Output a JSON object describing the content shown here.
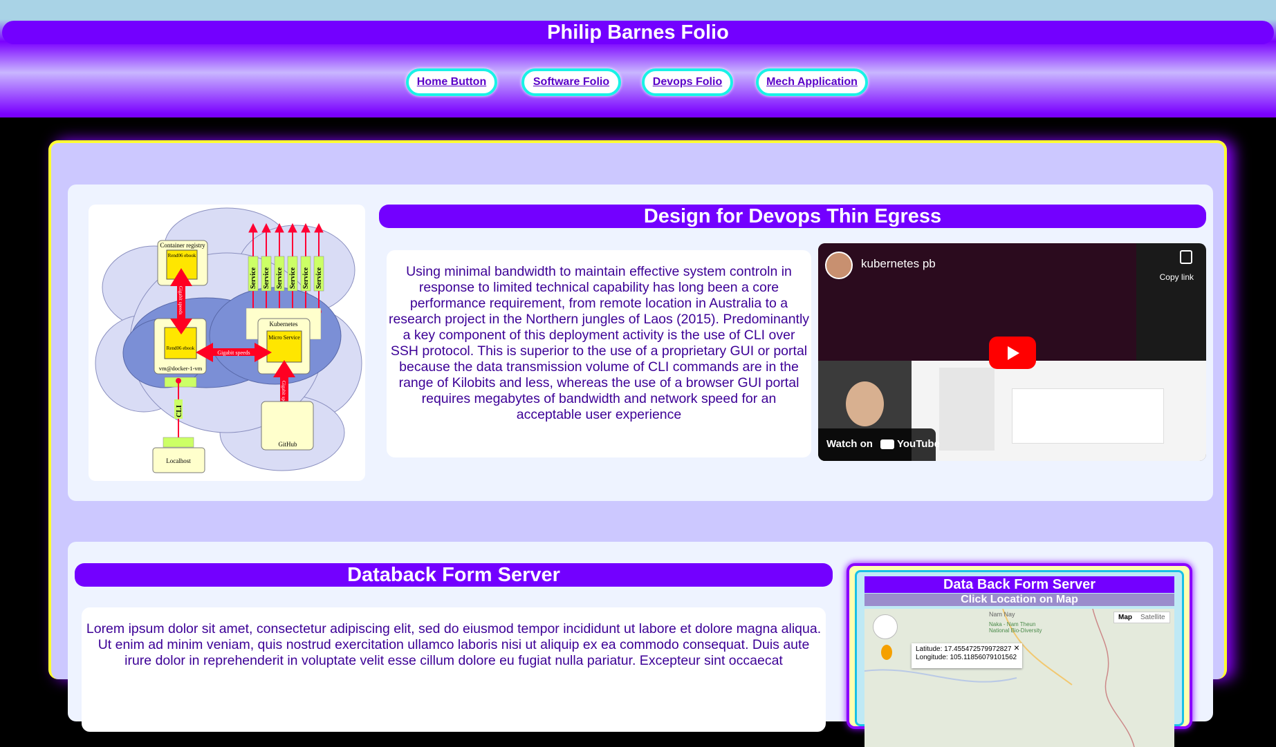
{
  "site": {
    "title": "Philip Barnes Folio"
  },
  "nav": [
    {
      "label": "Home Button"
    },
    {
      "label": "Software Folio"
    },
    {
      "label": "Devops Folio"
    },
    {
      "label": "Mech Application"
    }
  ],
  "diagram": {
    "registry_label": "Container registry",
    "registry_item": "Rend06 ebook",
    "vm_item": "Rend06 ebook",
    "vm_label": "vm@docker-1-vm",
    "gigabit_label": "Gigabit speeds",
    "gigabit_vertical": "Gigabit speeds",
    "kubernetes_label": "Kubernetes",
    "micro_service": "Micro Service",
    "service_label": "Service",
    "cli_label": "CLI",
    "localhost_label": "Localhost",
    "github_label": "GitHub",
    "gigabit_vertical2": "Gigabit speeds"
  },
  "section1": {
    "title": "Design for Devops Thin Egress",
    "body": "Using minimal bandwidth to maintain effective system controln in response to limited technical capability has long been a core performance requirement, from remote location in Australia to a research project in the Northern jungles of Laos (2015). Predominantly a key component of this deployment activity is the use of CLI over SSH protocol. This is superior to the use of a proprietary GUI or portal because the data transmission volume of CLI commands are in the range of Kilobits and less, whereas the use of a browser GUI portal requires megabytes of bandwidth and network speed for an acceptable user experience"
  },
  "video": {
    "title": "kubernetes pb",
    "copy_link": "Copy link",
    "watch_on": "Watch on",
    "youtube": "YouTube"
  },
  "section2": {
    "title": "Databack Form Server",
    "body": "Lorem ipsum dolor sit amet, consectetur adipiscing elit, sed do eiusmod tempor incididunt ut labore et dolore magna aliqua. Ut enim ad minim veniam, quis nostrud exercitation ullamco laboris nisi ut aliquip ex ea commodo consequat. Duis aute irure dolor in reprehenderit in voluptate velit esse cillum dolore eu fugiat nulla pariatur. Excepteur sint occaecat"
  },
  "map_card": {
    "title": "Data Back Form Server",
    "subtitle": "Click Location on Map",
    "map_btn": "Map",
    "satellite_btn": "Satellite",
    "place1": "Nam Nay",
    "place2": "Naka - Nam Theun National Bio-Diversity",
    "latitude": "Latitude: 17.455472579972827",
    "longitude": "Longitude: 105.11856079101562",
    "close": "×"
  }
}
